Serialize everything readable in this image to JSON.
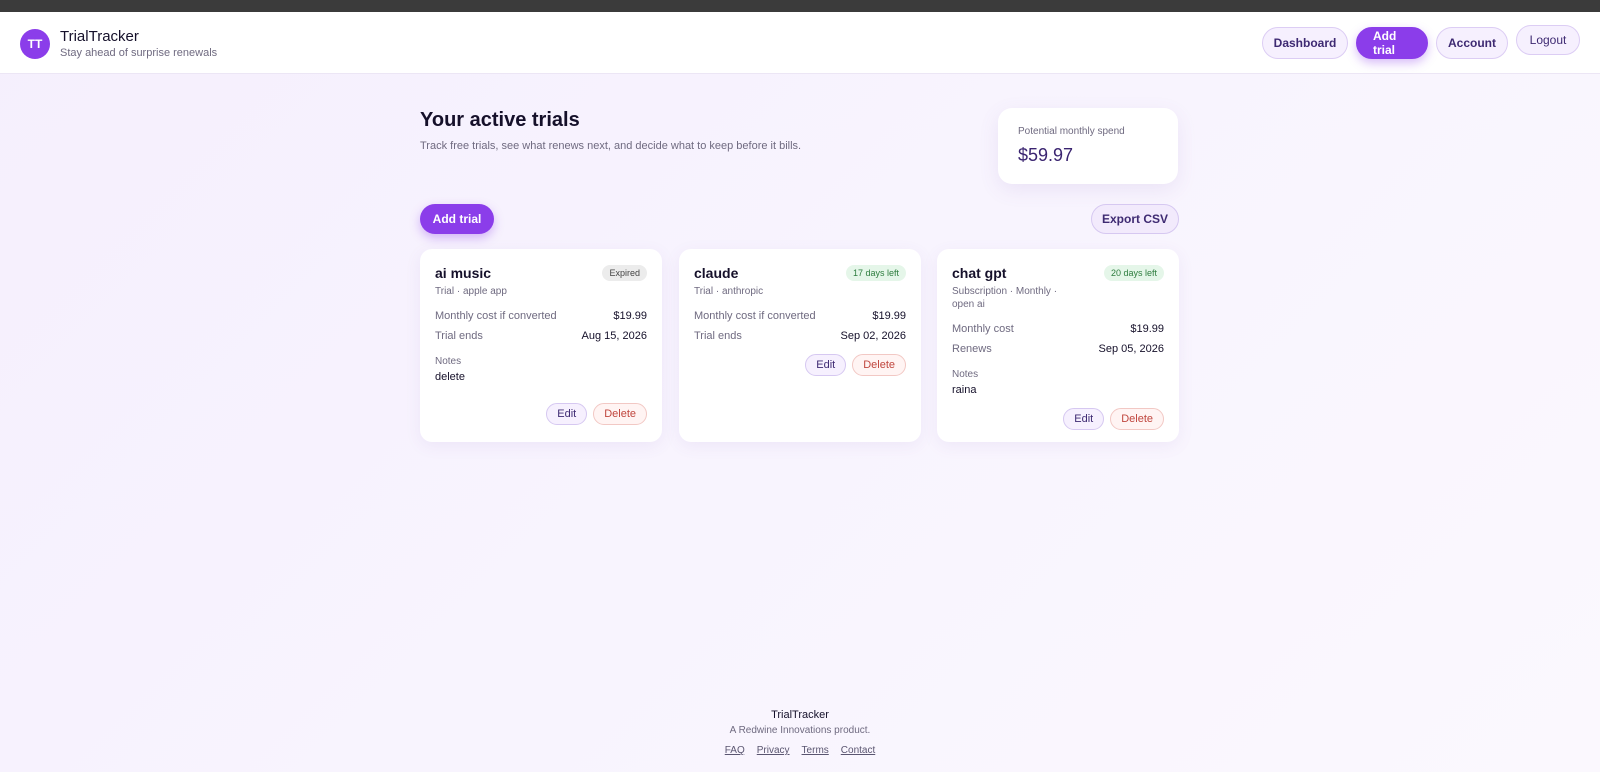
{
  "header": {
    "logo_initials": "TT",
    "app_name": "TrialTracker",
    "tagline": "Stay ahead of surprise renewals",
    "nav": {
      "dashboard": "Dashboard",
      "add_trial": "Add trial",
      "account": "Account",
      "logout": "Logout"
    }
  },
  "main": {
    "title": "Your active trials",
    "subtitle": "Track free trials, see what renews next, and decide what to keep before it bills.",
    "spend": {
      "label": "Potential monthly spend",
      "value": "$59.97"
    },
    "add_trial_label": "Add trial",
    "export_label": "Export CSV",
    "cards": [
      {
        "name": "ai music",
        "badge": "Expired",
        "meta": "Trial · apple app",
        "cost_label": "Monthly cost if converted",
        "cost": "$19.99",
        "date_label": "Trial ends",
        "date": "Aug 15, 2026",
        "notes_label": "Notes",
        "notes": "delete",
        "edit": "Edit",
        "delete": "Delete"
      },
      {
        "name": "claude",
        "badge": "17 days left",
        "meta": "Trial · anthropic",
        "cost_label": "Monthly cost if converted",
        "cost": "$19.99",
        "date_label": "Trial ends",
        "date": "Sep 02, 2026",
        "edit": "Edit",
        "delete": "Delete"
      },
      {
        "name": "chat gpt",
        "badge": "20 days left",
        "meta_line1": "Subscription · Monthly ·",
        "meta_line2": "open ai",
        "cost_label": "Monthly cost",
        "cost": "$19.99",
        "date_label": "Renews",
        "date": "Sep 05, 2026",
        "notes_label": "Notes",
        "notes": "raina",
        "edit": "Edit",
        "delete": "Delete"
      }
    ]
  },
  "footer": {
    "name": "TrialTracker",
    "tagline": "A Redwine Innovations product.",
    "links": [
      "FAQ",
      "Privacy",
      "Terms",
      "Contact"
    ]
  }
}
